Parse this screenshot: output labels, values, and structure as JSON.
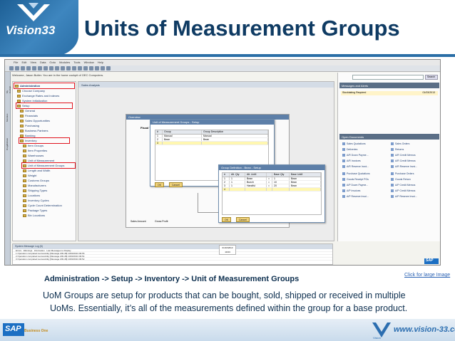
{
  "header": {
    "logo_text": "Vision33",
    "title": "Units of Measurement Groups"
  },
  "app": {
    "menu": [
      "File",
      "Edit",
      "View",
      "Data",
      "Goto",
      "Modules",
      "Tools",
      "Window",
      "Help"
    ],
    "welcome": "Welcome, Jason Butler. You are in the home cockpit of OEC Computers.",
    "side_tabs": [
      "My Cockpit",
      "Modules",
      "Drag&Relate"
    ],
    "sales_analysis": "Sales Analysis",
    "tree": [
      "Administration",
      "Choose Company",
      "Exchange Rates and Indexes",
      "System Initialization",
      "Setup",
      "General",
      "Financials",
      "Sales Opportunities",
      "Purchasing",
      "Business Partners",
      "Banking",
      "Inventory",
      "Item Groups",
      "Item Properties",
      "Warehouses",
      "Unit of Measurement",
      "Unit of Measurement Groups",
      "Length and Width",
      "Weight",
      "Customs Groups",
      "Manufacturers",
      "Shipping Types",
      "Locations",
      "Inventory Cycles",
      "Cycle Count Determination",
      "Package Types",
      "Bin Locations"
    ],
    "overview": {
      "title": "Overview",
      "currency": "Currency $",
      "fiscal": "Fiscal Year Analysis (BP)",
      "opportunity": "Opportunity Rel Rate",
      "radio_a": "Sales Amount",
      "radio_b": "Gross Profit",
      "last_updated": "Last Update: 10"
    },
    "uom_window": {
      "title": "Unit of Measurement Groups - Setup",
      "columns": [
        "#",
        "Group",
        "Group Description"
      ],
      "rows": [
        [
          "1",
          "Manual",
          "Manual"
        ],
        [
          "2",
          "Bean",
          "Bean"
        ],
        [
          "3",
          "",
          ""
        ]
      ],
      "ok": "OK",
      "cancel": "Cancel"
    },
    "group_def_window": {
      "title": "Group Definition - Bean - Setup",
      "columns": [
        "#",
        "Alt. Qty",
        "Alt. UoM",
        "",
        "Base Qty",
        "Base UoM"
      ],
      "rows": [
        [
          "1",
          "1",
          "Bean",
          "=",
          "1",
          "Bean"
        ],
        [
          "2",
          "1",
          "Bunch",
          "=",
          "10",
          "Bean"
        ],
        [
          "3",
          "1",
          "Handful",
          "=",
          "20",
          "Bean"
        ],
        [
          "4",
          "",
          "",
          "",
          "",
          ""
        ]
      ],
      "ok": "OK",
      "cancel": "Cancel"
    },
    "search_label": "Search",
    "messages": {
      "title": "Messages and Alerts",
      "row": "Stocktaking Required",
      "row_date": "01/03/2013"
    },
    "docs": {
      "title": "Open Documents",
      "left": [
        "Sales Quotations",
        "Deliveries",
        "A/R Down Payme...",
        "A/R Invoices",
        "A/R Reserve Invoi...",
        "Purchase Quotations",
        "Goods Receipt POs",
        "A/P Down Payme...",
        "A/P Invoices",
        "A/P Reserve Invoi..."
      ],
      "right": [
        "Sales Orders",
        "Returns",
        "A/R Credit Memos",
        "A/R Credit Memos",
        "A/R Reserve Invoi...",
        "Purchase Orders",
        "Goods Return",
        "A/P Credit Memos",
        "A/P Credit Memos",
        "A/P Reserve Invoi..."
      ]
    },
    "system_log": {
      "title": "System Message Log (6)",
      "filters": [
        "Errors",
        "Warnings",
        "Information",
        "Last Messages to Display"
      ],
      "columns": [
        "#",
        "Message",
        "Help",
        "Feedback",
        "Contact",
        "Date | Time",
        "Message ID"
      ],
      "rows": [
        "1  Operation completed successfully [Message 200-48]  10/03/2013  09:55",
        "2  Operation completed successfully [Message 200-48]  10/03/2013  09:54",
        "3  Operation completed successfully [Message 200-48]  10/03/2013  09:52",
        "4  Operation completed successfully [Message 200-48]  10/03/2013  09:50"
      ]
    },
    "date": "01/10/2013",
    "time": "10:03",
    "sap_small": "SAP"
  },
  "click_link": "Click for large Image",
  "path": "Administration -> Setup -> Inventory -> Unit of Measurement Groups",
  "description_line1": "UoM Groups are setup for products that can be bought, sold, shipped or received in multiple",
  "description_line2": "UoMs. Essentially, it’s all of the measurements defined within the group for a base product.",
  "footer": {
    "sap": "SAP",
    "sap_sub": "Business One",
    "url": "www.vision-33.com",
    "vision": "Vision"
  },
  "colors": {
    "title": "#0f3b63",
    "highlight": "#e0141e",
    "brand_blue": "#2a6ea6"
  }
}
